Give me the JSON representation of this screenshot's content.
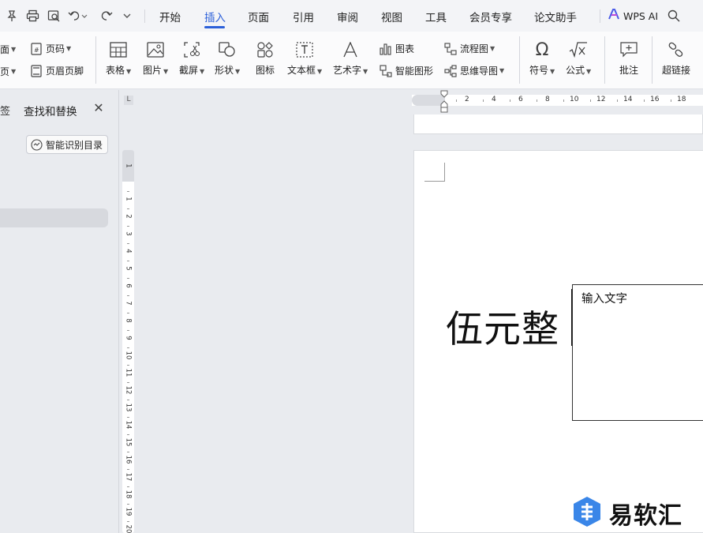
{
  "menubar": {
    "quick_icons": [
      "pin-icon",
      "print-icon",
      "print-preview-icon",
      "undo-icon",
      "redo-icon",
      "more-chevron-icon"
    ],
    "tabs": [
      {
        "label": "开始",
        "active": false
      },
      {
        "label": "插入",
        "active": true
      },
      {
        "label": "页面",
        "active": false
      },
      {
        "label": "引用",
        "active": false
      },
      {
        "label": "审阅",
        "active": false
      },
      {
        "label": "视图",
        "active": false
      },
      {
        "label": "工具",
        "active": false
      },
      {
        "label": "会员专享",
        "active": false
      },
      {
        "label": "论文助手",
        "active": false
      }
    ],
    "wps_ai_label": "WPS AI",
    "accent_color": "#2b5fd9"
  },
  "ribbon": {
    "partial_top": "面",
    "partial_bottom": "页",
    "page_number": "页码",
    "header_footer": "页眉页脚",
    "table": "表格",
    "picture": "图片",
    "screenshot": "截屏",
    "shape": "形状",
    "icon": "图标",
    "textbox": "文本框",
    "wordart": "艺术字",
    "chart": "图表",
    "smart_graphic": "智能图形",
    "flowchart": "流程图",
    "mindmap": "思维导图",
    "symbol": "符号",
    "formula": "公式",
    "comment": "批注",
    "hyperlink": "超链接"
  },
  "left_panel": {
    "partial_tab": "签",
    "title": "查找和替换",
    "smart_toc_button": "智能识别目录"
  },
  "rulers": {
    "horizontal": [
      "2",
      "4",
      "6",
      "8",
      "10",
      "12",
      "14",
      "16",
      "18"
    ],
    "vertical": [
      "1",
      "1",
      "2",
      "3",
      "4",
      "5",
      "6",
      "7",
      "8",
      "9",
      "10",
      "11",
      "12",
      "13",
      "14",
      "15",
      "16",
      "17",
      "18",
      "19",
      "20"
    ]
  },
  "document": {
    "body_text": "伍元整",
    "textbox_placeholder": "输入文字"
  },
  "watermark": {
    "text": "易软汇",
    "accent_color": "#3a86e8"
  }
}
